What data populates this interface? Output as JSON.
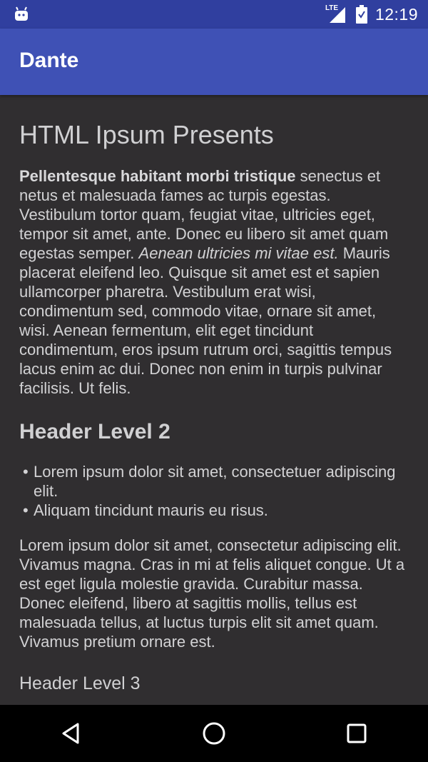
{
  "status_bar": {
    "time": "12:19",
    "network_label": "LTE",
    "icons": [
      "android-icon",
      "signal-icon",
      "battery-icon"
    ],
    "background": "#303f9f"
  },
  "app_bar": {
    "title": "Dante",
    "background": "#3f51b5"
  },
  "content": {
    "title": "HTML Ipsum Presents",
    "paragraph1": {
      "bold": "Pellentesque habitant morbi tristique",
      "text1": " senectus et netus et malesuada fames ac turpis egestas. Vestibulum tortor quam, feugiat vitae, ultricies eget, tempor sit amet, ante. Donec eu libero sit amet quam egestas semper. ",
      "italic": "Aenean ultricies mi vitae est.",
      "text2": " Mauris placerat eleifend leo. Quisque sit amet est et sapien ullamcorper pharetra. Vestibulum erat wisi, condimentum sed, commodo vitae, ornare sit amet, wisi. Aenean fermentum, elit eget tincidunt condimentum, eros ipsum rutrum orci, sagittis tempus lacus enim ac dui. Donec non enim in turpis pulvinar facilisis. Ut felis."
    },
    "header2": "Header Level 2",
    "list_bullet": "•",
    "list_items": [
      "Lorem ipsum dolor sit amet, consectetuer adipiscing elit.",
      "Aliquam tincidunt mauris eu risus."
    ],
    "paragraph2": "Lorem ipsum dolor sit amet, consectetur adipiscing elit. Vivamus magna. Cras in mi at felis aliquet congue. Ut a est eget ligula molestie gravida. Curabitur massa. Donec eleifend, libero at sagittis mollis, tellus est malesuada tellus, at luctus turpis elit sit amet quam. Vivamus pretium ornare est.",
    "header3": "Header Level 3",
    "background": "#302e30"
  },
  "nav_bar": {
    "buttons": [
      "back-icon",
      "home-icon",
      "recents-icon"
    ]
  }
}
